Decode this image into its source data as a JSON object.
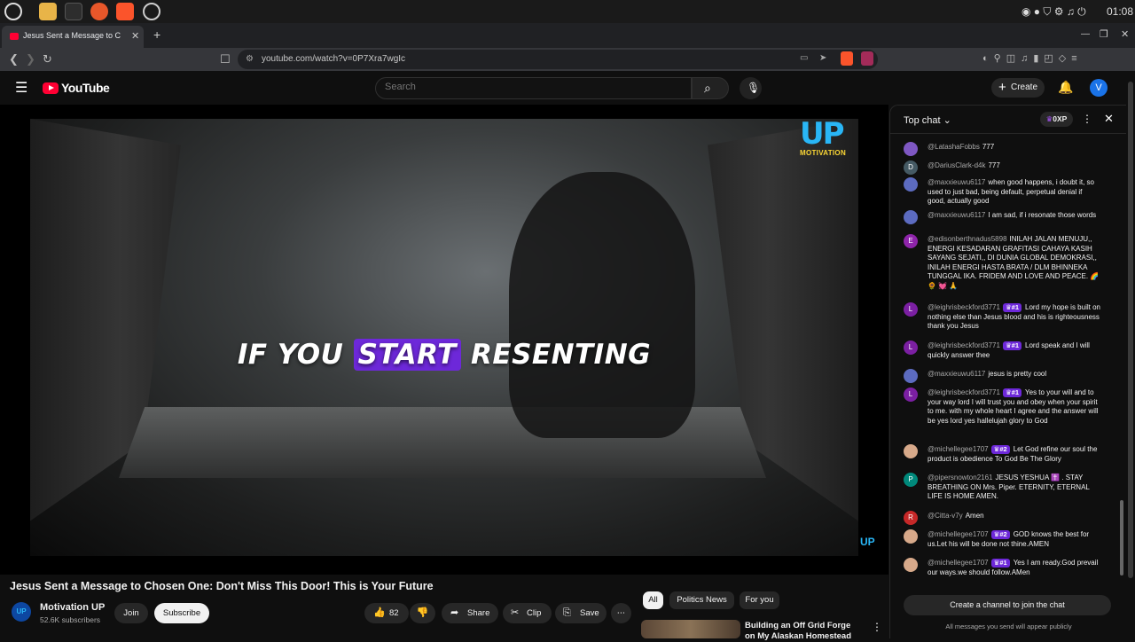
{
  "os": {
    "clock": "01:08"
  },
  "browser": {
    "tab_title": "Jesus Sent a Message to C",
    "url": "youtube.com/watch?v=0P7Xra7wgIc",
    "new_tab": "+",
    "tab_close": "✕",
    "win_min": "—",
    "win_max": "❐",
    "win_close": "✕"
  },
  "yt": {
    "logo": "YouTube",
    "search_placeholder": "Search",
    "create_label": "Create",
    "avatar_letter": "V"
  },
  "video": {
    "caption_before": "IF YOU ",
    "caption_highlight": "START",
    "caption_after": " RESENTING",
    "brand_up": "UP",
    "brand_motivation": "MOTIVATION",
    "brand_small": "UP",
    "title": "Jesus Sent a Message to Chosen One: Don't Miss This Door! This is Your Future"
  },
  "channel": {
    "avatar_text": "UP",
    "name": "Motivation UP",
    "subs": "52.6K subscribers",
    "join": "Join",
    "subscribe": "Subscribe"
  },
  "actions": {
    "likes": "82",
    "share": "Share",
    "clip": "Clip",
    "save": "Save",
    "more": "⋯"
  },
  "chips": [
    "All",
    "Politics News",
    "For you"
  ],
  "recommended": {
    "title": "Building an Off Grid Forge on My Alaskan Homestead"
  },
  "chat": {
    "header": "Top chat",
    "points": "0XP",
    "input_placeholder": "Create a channel to join the chat",
    "note": "All messages you send will appear publicly",
    "messages": [
      {
        "author": "@LatashaFobbs",
        "text": "777",
        "avatar": "",
        "color": "#7e57c2",
        "badge": ""
      },
      {
        "author": "@DariusClark-d4k",
        "text": "777",
        "avatar": "D",
        "color": "#455a64",
        "badge": ""
      },
      {
        "author": "@maxxieuwu6117",
        "text": "when good happens, i doubt it, so used to just bad, being default, perpetual denial if good, actually good",
        "avatar": "",
        "color": "#5c6bc0",
        "badge": ""
      },
      {
        "author": "@maxxieuwu6117",
        "text": "I am sad, if i resonate those words",
        "avatar": "",
        "color": "#5c6bc0",
        "badge": ""
      },
      {
        "author": "@edisonberthnadus5898",
        "text": "INILAH JALAN MENUJU,, ENERGI KESADARAN GRAFITASI CAHAYA KASIH SAYANG SEJATI,, DI DUNIA GLOBAL DEMOKRASI,, INILAH ENERGI HASTA BRATA / DLM BHINNEKA TUNGGAL IKA. FRIDEM AND LOVE AND PEACE. 🌈 🌻 💓 🙏",
        "avatar": "E",
        "color": "#8e24aa",
        "badge": ""
      },
      {
        "author": "@leighrisbeckford3771",
        "text": "Lord my hope is built on nothing else than Jesus blood and his is righteousness thank you Jesus",
        "avatar": "L",
        "color": "#7b1fa2",
        "badge": "♛#1"
      },
      {
        "author": "@leighrisbeckford3771",
        "text": "Lord speak and I will quickly answer thee",
        "avatar": "L",
        "color": "#7b1fa2",
        "badge": "♛#1"
      },
      {
        "author": "@maxxieuwu6117",
        "text": "jesus is pretty cool",
        "avatar": "",
        "color": "#5c6bc0",
        "badge": ""
      },
      {
        "author": "@leighrisbeckford3771",
        "text": "Yes to your will and to your way lord I will trust you and obey when your spirit to me. with my whole heart I agree and the answer will be yes lord yes hallelujah glory to God",
        "avatar": "L",
        "color": "#7b1fa2",
        "badge": "♛#1"
      },
      {
        "author": "@michellegee1707",
        "text": "Let God refine our soul the product is obedience To God Be The Glory",
        "avatar": "",
        "color": "#d7a98a",
        "badge": "♛#2"
      },
      {
        "author": "@pipersnowton2161",
        "text": "JESUS YESHUA ✝️ . STAY BREATHING ON Mrs. Piper. ETERNITY, ETERNAL LIFE IS HOME AMEN.",
        "avatar": "P",
        "color": "#00897b",
        "badge": ""
      },
      {
        "author": "@Citta-v7y",
        "text": "Amen",
        "avatar": "R",
        "color": "#c62828",
        "badge": ""
      },
      {
        "author": "@michellegee1707",
        "text": "GOD knows the best for us.Let his will be done not thine.AMEN",
        "avatar": "",
        "color": "#d7a98a",
        "badge": "♛#2"
      },
      {
        "author": "@michellegee1707",
        "text": "Yes I am ready.God prevail our ways.we should follow.AMen",
        "avatar": "",
        "color": "#d7a98a",
        "badge": "♛#1"
      }
    ]
  }
}
